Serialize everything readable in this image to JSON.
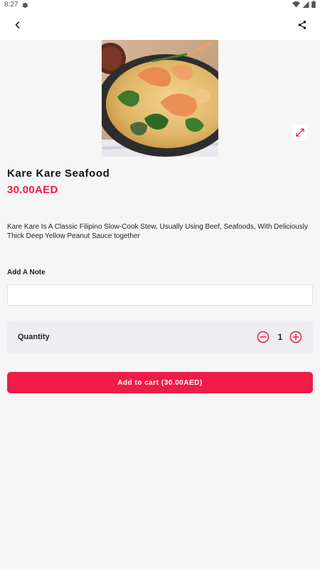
{
  "status_bar": {
    "time": "8:27",
    "icons": [
      "settings-icon",
      "wifi-icon",
      "signal-icon",
      "battery-icon"
    ]
  },
  "app_bar": {
    "back_icon": "chevron-left-icon",
    "share_icon": "share-icon"
  },
  "product": {
    "image_icon": "food-photo",
    "expand_icon": "expand-icon",
    "title": "Kare Kare Seafood",
    "price": "30.00AED",
    "description": "Kare Kare Is A Classic Filipino Slow-Cook Stew, Usually Using Beef, Seafoods, With Deliciously Thick Deep Yellow Peanut Sauce together"
  },
  "note": {
    "label": "Add A Note",
    "value": "",
    "placeholder": ""
  },
  "quantity": {
    "label": "Quantity",
    "value": "1",
    "minus_icon": "minus-circle-icon",
    "plus_icon": "plus-circle-icon"
  },
  "cart_button": {
    "label": "Add to cart (30.00AED)"
  },
  "colors": {
    "accent": "#ee1c47",
    "background": "#f6f6f6",
    "quantity_box": "#eeeef2"
  }
}
